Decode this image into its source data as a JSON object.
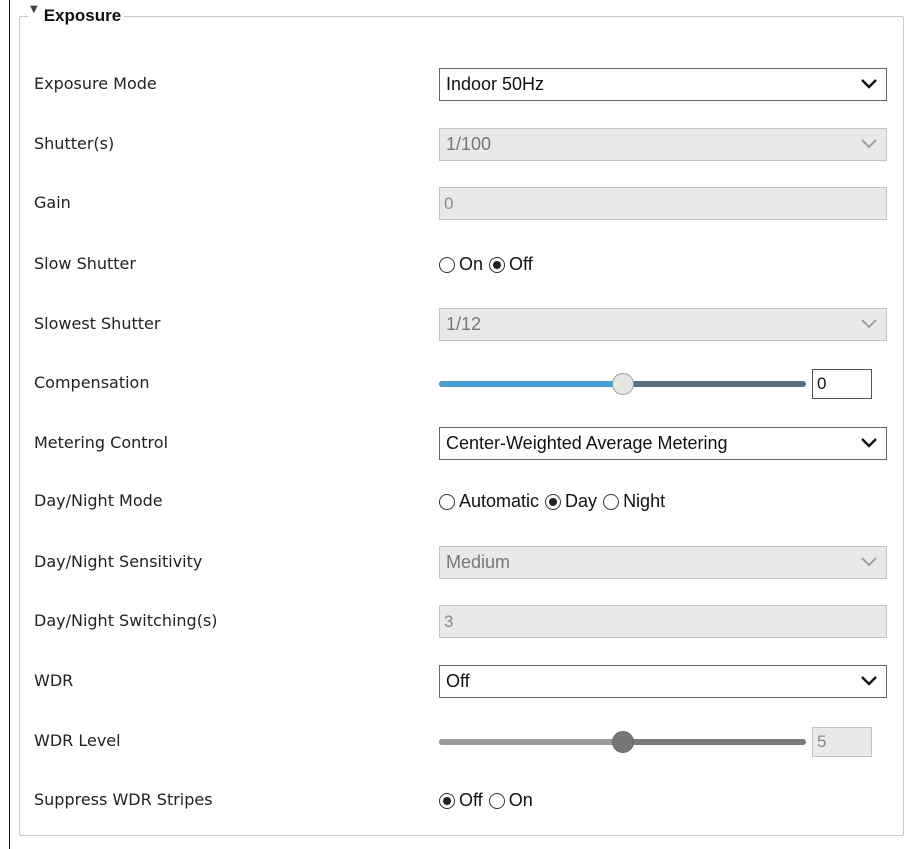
{
  "section": {
    "title": "Exposure",
    "collapse_icon": "triangle-down-icon"
  },
  "fields": {
    "exposure_mode": {
      "label": "Exposure Mode",
      "value": "Indoor 50Hz"
    },
    "shutter": {
      "label": "Shutter(s)",
      "value": "1/100"
    },
    "gain": {
      "label": "Gain",
      "value": "0"
    },
    "slow_shutter": {
      "label": "Slow Shutter",
      "options": [
        "On",
        "Off"
      ],
      "selected": "Off"
    },
    "slowest_shutter": {
      "label": "Slowest Shutter",
      "value": "1/12"
    },
    "compensation": {
      "label": "Compensation",
      "value": "0",
      "slider_fraction": 0.5
    },
    "metering_control": {
      "label": "Metering Control",
      "value": "Center-Weighted Average Metering"
    },
    "day_night_mode": {
      "label": "Day/Night Mode",
      "options": [
        "Automatic",
        "Day",
        "Night"
      ],
      "selected": "Day"
    },
    "day_night_sensitivity": {
      "label": "Day/Night Sensitivity",
      "value": "Medium"
    },
    "day_night_switching": {
      "label": "Day/Night Switching(s)",
      "value": "3"
    },
    "wdr": {
      "label": "WDR",
      "value": "Off"
    },
    "wdr_level": {
      "label": "WDR Level",
      "value": "5",
      "slider_fraction": 0.5
    },
    "suppress_wdr_stripes": {
      "label": "Suppress WDR Stripes",
      "options": [
        "Off",
        "On"
      ],
      "selected": "Off"
    }
  },
  "colors": {
    "slider_active": "#4a9fd0",
    "slider_track": "#5c6f7e",
    "disabled_bg": "#e9e9e9"
  }
}
